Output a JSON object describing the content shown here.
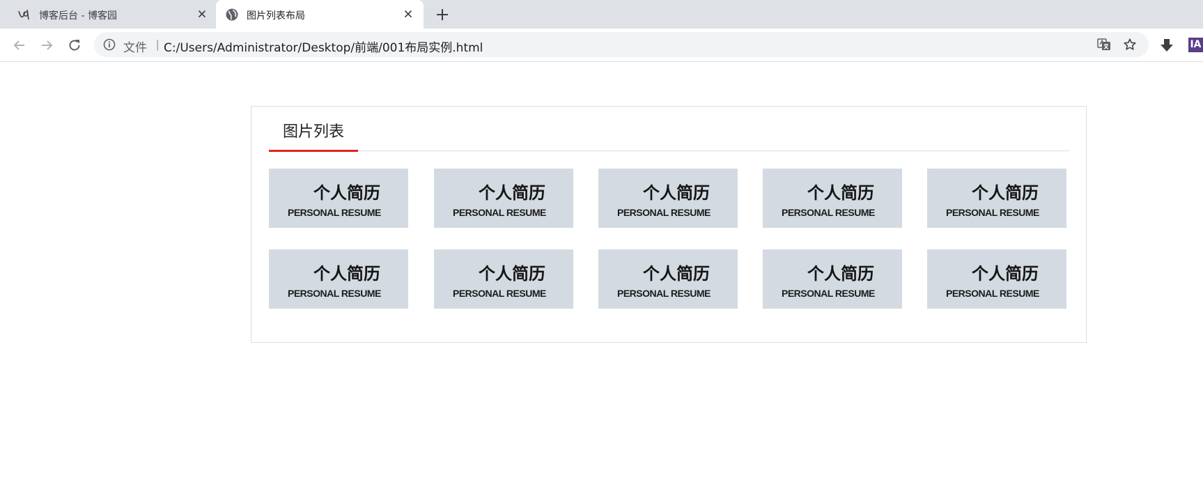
{
  "tabs": [
    {
      "title": "博客后台 - 博客园",
      "active": false,
      "icon": "cnblogs-icon"
    },
    {
      "title": "图片列表布局",
      "active": true,
      "icon": "globe-icon"
    }
  ],
  "toolbar": {
    "scheme_label": "文件",
    "url": "C:/Users/Administrator/Desktop/前端/001布局实例.html",
    "extension_label": "IA"
  },
  "panel": {
    "title": "图片列表",
    "accent_color": "#e2231a"
  },
  "thumbnails": [
    {
      "cn": "个人简历",
      "en": "PERSONAL RESUME"
    },
    {
      "cn": "个人简历",
      "en": "PERSONAL RESUME"
    },
    {
      "cn": "个人简历",
      "en": "PERSONAL RESUME"
    },
    {
      "cn": "个人简历",
      "en": "PERSONAL RESUME"
    },
    {
      "cn": "个人简历",
      "en": "PERSONAL RESUME"
    },
    {
      "cn": "个人简历",
      "en": "PERSONAL RESUME"
    },
    {
      "cn": "个人简历",
      "en": "PERSONAL RESUME"
    },
    {
      "cn": "个人简历",
      "en": "PERSONAL RESUME"
    },
    {
      "cn": "个人简历",
      "en": "PERSONAL RESUME"
    },
    {
      "cn": "个人简历",
      "en": "PERSONAL RESUME"
    }
  ]
}
